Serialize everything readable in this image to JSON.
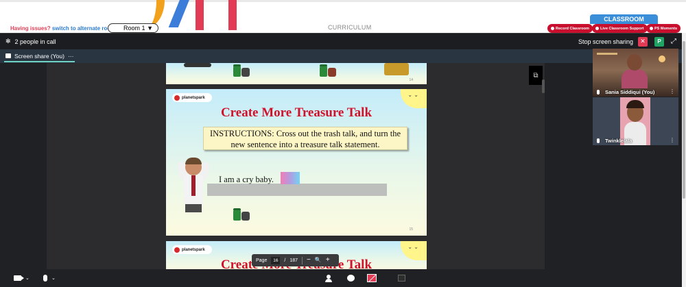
{
  "site": {
    "issues_text": "Having issues?",
    "alternate_link": "switch to alternate room",
    "room_value": "Room 1",
    "curriculum": "CURRICULUM",
    "classroom_tab": "CLASSROOM",
    "pills": [
      "Record Classroom",
      "Live Classroom Support",
      "PS Moments"
    ]
  },
  "call": {
    "people_count": "2 people in call",
    "stop_share": "Stop screen sharing",
    "self_avatar": "P",
    "tab_label": "Screen share (You)",
    "tab_more": "···"
  },
  "slides": {
    "prev_page": "14",
    "page_label": "15",
    "logo_text": "planetspark",
    "title": "Create More Treasure Talk",
    "instructions": "INSTRUCTIONS: Cross out the trash talk, and turn the new sentence into a treasure talk statement.",
    "sentence": "I am a cry baby.",
    "next_title": "Create More Treasure Talk"
  },
  "pdf_toolbar": {
    "page_label": "Page",
    "current_page": "16",
    "separator": "/",
    "total_pages": "187",
    "zoom_out": "−",
    "zoom_in": "+",
    "zoom_icon": "🔍"
  },
  "participants": [
    {
      "name": "Sania Siddiqui (You)"
    },
    {
      "name": "Twinklelala"
    }
  ],
  "icons": {
    "settings": "gear-icon",
    "close": "close-icon",
    "expand": "expand-icon",
    "popout": "external-link-icon",
    "camera": "camera-icon",
    "mic": "microphone-icon",
    "people": "person-icon",
    "chat": "chat-icon",
    "share_stop": "stop-share-icon",
    "grid": "grid-icon"
  },
  "colors": {
    "accent_red": "#e23b55",
    "brand_blue": "#3a8fd8",
    "pill_red": "#c8102e",
    "green_avatar": "#1fa463",
    "tab_underline": "#6fd3c3"
  }
}
